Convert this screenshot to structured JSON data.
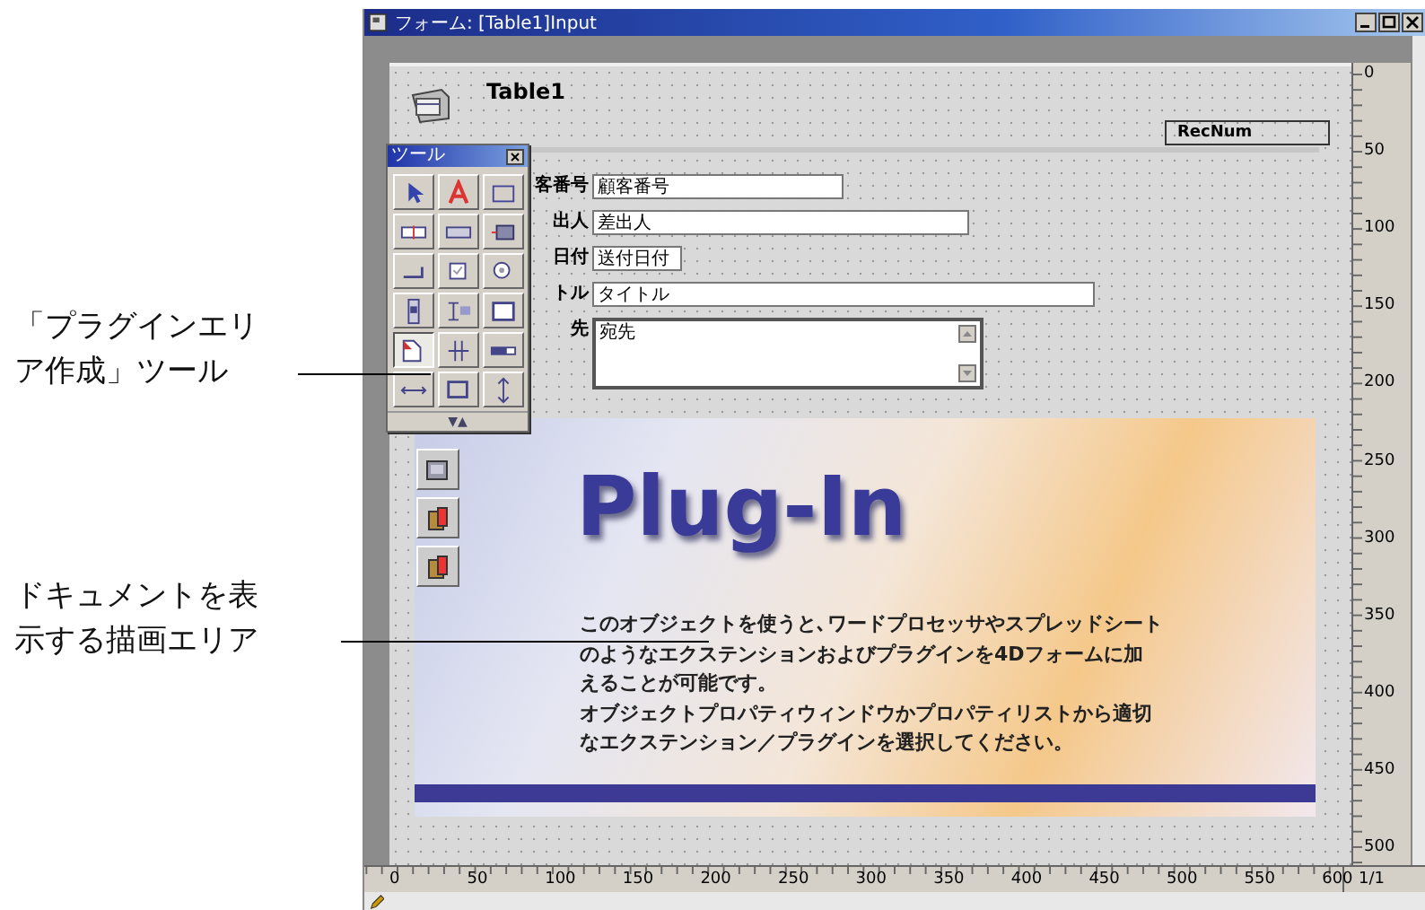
{
  "callouts": [
    {
      "lines": [
        "「プラグインエリ",
        "ア作成」ツール"
      ]
    },
    {
      "lines": [
        "ドキュメントを表",
        "示する描画エリア"
      ]
    }
  ],
  "window": {
    "title": "フォーム: [Table1]Input"
  },
  "header": {
    "table_name": "Table1",
    "recnum_field": "RecNum"
  },
  "fields": [
    {
      "label": "客番号",
      "value": "顧客番号",
      "kind": "short"
    },
    {
      "label": "出人",
      "value": "差出人",
      "kind": "medium"
    },
    {
      "label": "日付",
      "value": "送付日付",
      "kind": "tiny"
    },
    {
      "label": "トル",
      "value": "タイトル",
      "kind": "long"
    },
    {
      "label": "先",
      "value": "宛先",
      "kind": "area"
    }
  ],
  "plugin_area": {
    "title": "Plug-In",
    "text": [
      "このオブジェクトを使うと､ワードプロセッサやスプレッドシート",
      "のようなエクステンションおよびプラグインを4Dフォームに加",
      "えることが可能です。",
      "オブジェクトプロパティウィンドウかプロパティリストから適切",
      "なエクステンション／プラグインを選択してください。"
    ]
  },
  "tool_palette": {
    "title": "ツール",
    "toggle": "▼▲",
    "tools": [
      {
        "kind": "pointer",
        "selected": false
      },
      {
        "kind": "text",
        "selected": false
      },
      {
        "kind": "group",
        "selected": false
      },
      {
        "kind": "field",
        "selected": false
      },
      {
        "kind": "input",
        "selected": false
      },
      {
        "kind": "picture",
        "selected": false
      },
      {
        "kind": "button",
        "selected": false
      },
      {
        "kind": "checkbox",
        "selected": false
      },
      {
        "kind": "radio",
        "selected": false
      },
      {
        "kind": "scroll",
        "selected": false
      },
      {
        "kind": "list",
        "selected": false
      },
      {
        "kind": "tab",
        "selected": false
      },
      {
        "kind": "plugin",
        "selected": true
      },
      {
        "kind": "grid",
        "selected": false
      },
      {
        "kind": "slider",
        "selected": false
      },
      {
        "kind": "line",
        "selected": false
      },
      {
        "kind": "rect",
        "selected": false
      },
      {
        "kind": "splitter",
        "selected": false
      }
    ]
  },
  "side_tools": [
    {
      "kind": "library"
    },
    {
      "kind": "book"
    },
    {
      "kind": "book"
    }
  ],
  "right_ruler": [
    "0",
    "50",
    "100",
    "150",
    "200",
    "250",
    "300",
    "350",
    "400",
    "450",
    "500"
  ],
  "bottom_ruler": [
    "0",
    "50",
    "100",
    "150",
    "200",
    "250",
    "300",
    "350",
    "400",
    "450",
    "500",
    "550",
    "600"
  ],
  "page_indicator": "1/1"
}
